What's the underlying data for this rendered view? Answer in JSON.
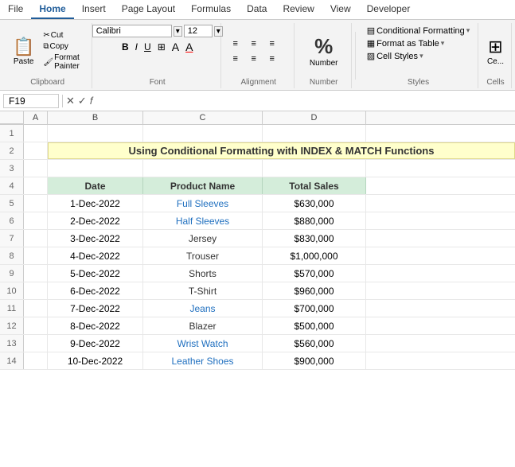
{
  "tabs": {
    "items": [
      "File",
      "Home",
      "Insert",
      "Page Layout",
      "Formulas",
      "Data",
      "Review",
      "View",
      "Developer"
    ]
  },
  "active_tab": "Home",
  "groups": {
    "clipboard": {
      "label": "Clipboard",
      "paste": "Paste",
      "cut": "✂",
      "copy": "⧉",
      "format_painter": "🖌"
    },
    "font": {
      "label": "Font",
      "name": "Calibri",
      "size": "12",
      "bold": "B",
      "italic": "I",
      "underline": "U"
    },
    "alignment": {
      "label": "Alignment"
    },
    "number": {
      "label": "Number",
      "format": "Number"
    },
    "styles": {
      "label": "Styles",
      "conditional_formatting": "Conditional Formatting",
      "format_as_table": "Format as Table",
      "cell_styles": "Cell Styles"
    },
    "cells": {
      "label": "Cells",
      "icon": "⊞"
    }
  },
  "formula_bar": {
    "cell_ref": "F19",
    "placeholder": ""
  },
  "spreadsheet": {
    "title": "Using Conditional Formatting with INDEX & MATCH Functions",
    "headers": [
      "Date",
      "Product Name",
      "Total Sales"
    ],
    "rows": [
      {
        "date": "1-Dec-2022",
        "product": "Full Sleeves",
        "sales": "$630,000",
        "highlight": true
      },
      {
        "date": "2-Dec-2022",
        "product": "Half Sleeves",
        "sales": "$880,000",
        "highlight": true
      },
      {
        "date": "3-Dec-2022",
        "product": "Jersey",
        "sales": "$830,000",
        "highlight": false
      },
      {
        "date": "4-Dec-2022",
        "product": "Trouser",
        "sales": "$1,000,000",
        "highlight": false
      },
      {
        "date": "5-Dec-2022",
        "product": "Shorts",
        "sales": "$570,000",
        "highlight": false
      },
      {
        "date": "6-Dec-2022",
        "product": "T-Shirt",
        "sales": "$960,000",
        "highlight": false
      },
      {
        "date": "7-Dec-2022",
        "product": "Jeans",
        "sales": "$700,000",
        "highlight": true
      },
      {
        "date": "8-Dec-2022",
        "product": "Blazer",
        "sales": "$500,000",
        "highlight": false
      },
      {
        "date": "9-Dec-2022",
        "product": "Wrist Watch",
        "sales": "$560,000",
        "highlight": true
      },
      {
        "date": "10-Dec-2022",
        "product": "Leather Shoes",
        "sales": "$900,000",
        "highlight": true
      }
    ],
    "col_labels": [
      "A",
      "B",
      "C",
      "D"
    ],
    "row_numbers": [
      1,
      2,
      3,
      4,
      5,
      6,
      7,
      8,
      9,
      10,
      11,
      12,
      13,
      14
    ]
  }
}
